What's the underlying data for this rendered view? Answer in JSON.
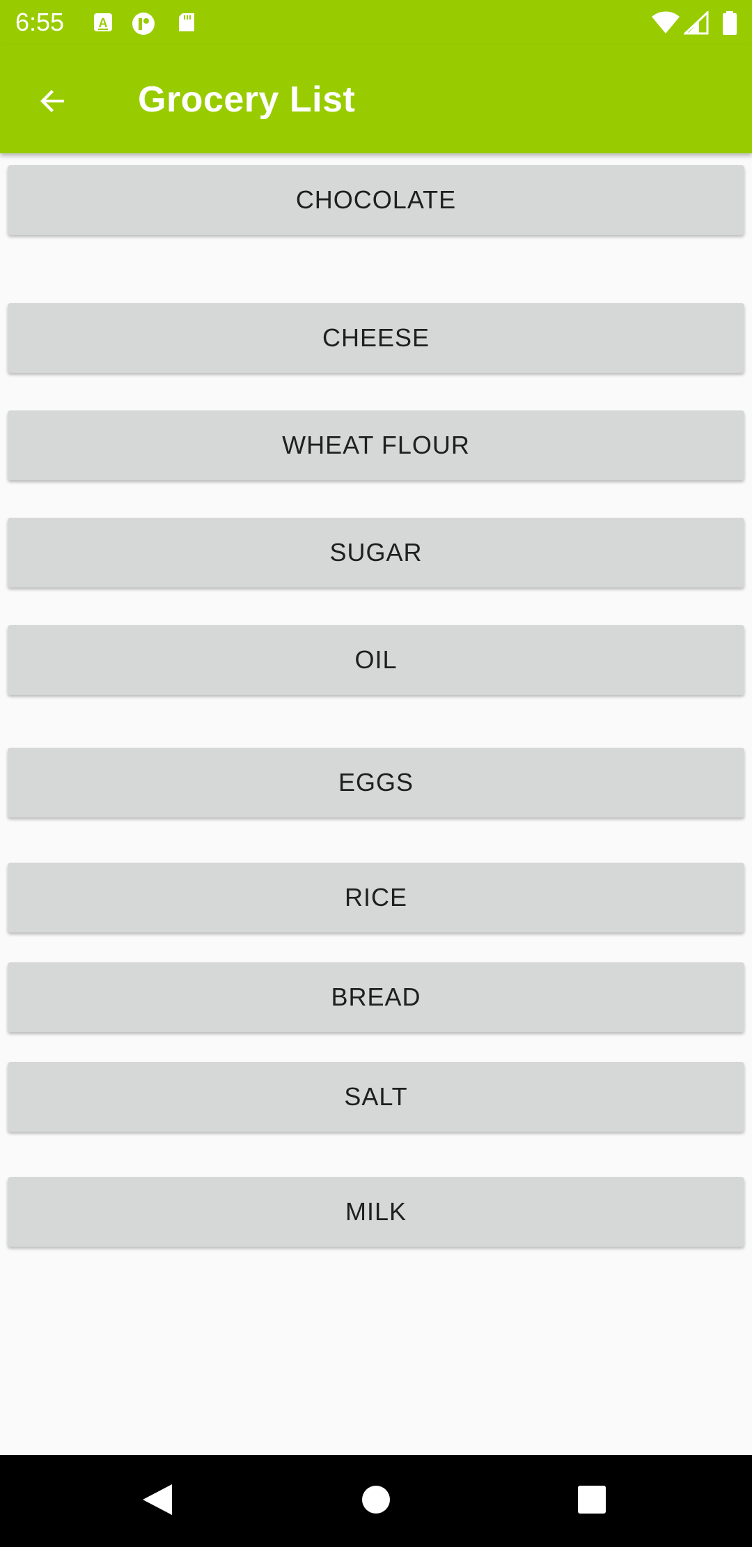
{
  "status_bar": {
    "time": "6:55",
    "notification_icons": [
      "a-icon",
      "logo-icon",
      "sd-card-icon"
    ],
    "system_icons": [
      "wifi-icon",
      "signal-icon",
      "battery-icon"
    ]
  },
  "app_bar": {
    "title": "Grocery List",
    "back_icon": "arrow-left-icon",
    "color": "#99cc00"
  },
  "items": [
    {
      "label": "CHOCOLATE"
    },
    {
      "label": "CHEESE"
    },
    {
      "label": "WHEAT FLOUR"
    },
    {
      "label": "SUGAR"
    },
    {
      "label": "OIL"
    },
    {
      "label": "EGGS"
    },
    {
      "label": "RICE"
    },
    {
      "label": "BREAD"
    },
    {
      "label": "SALT"
    },
    {
      "label": "MILK"
    }
  ],
  "nav_bar": {
    "buttons": [
      "back-triangle-icon",
      "home-circle-icon",
      "recents-square-icon"
    ]
  },
  "colors": {
    "accent": "#99cc00",
    "button_bg": "#d6d7d7",
    "background": "#fafafa"
  }
}
